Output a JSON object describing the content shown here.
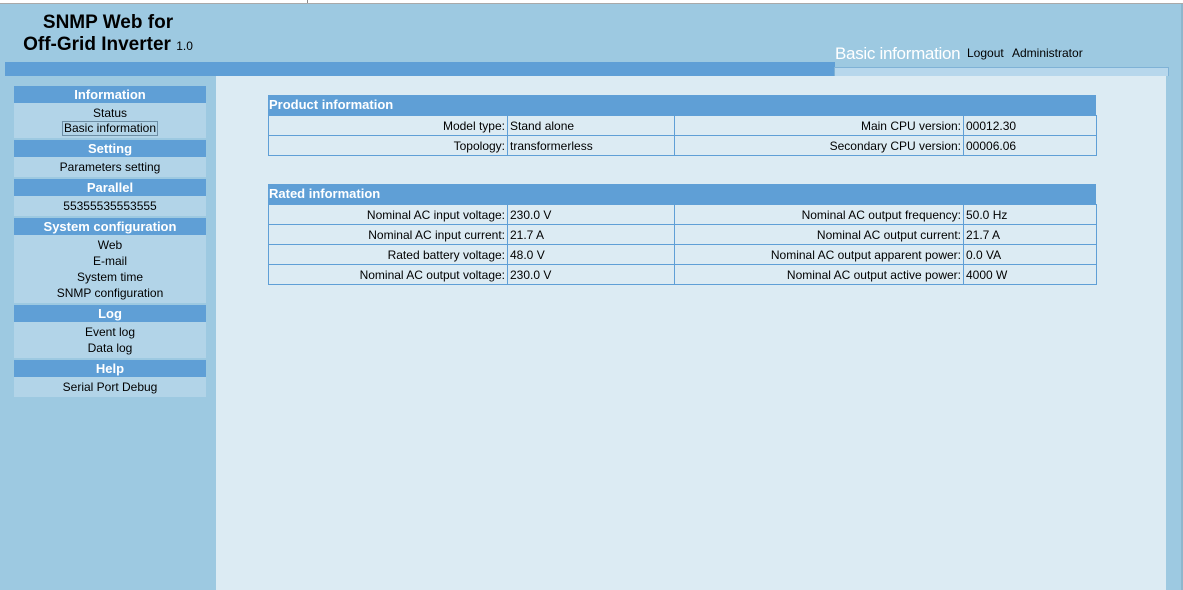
{
  "header": {
    "title_line1": "SNMP Web for",
    "title_line2": "Off-Grid Inverter",
    "version": "1.0",
    "page_title": "Basic information",
    "logout_label": "Logout",
    "user": "Administrator"
  },
  "sidebar": {
    "sections": [
      {
        "title": "Information",
        "items": [
          "Status",
          "Basic information"
        ]
      },
      {
        "title": "Setting",
        "items": [
          "Parameters setting"
        ]
      },
      {
        "title": "Parallel",
        "items": [
          "55355535553555"
        ]
      },
      {
        "title": "System configuration",
        "items": [
          "Web",
          "E-mail",
          "System time",
          "SNMP configuration"
        ]
      },
      {
        "title": "Log",
        "items": [
          "Event log",
          "Data log"
        ]
      },
      {
        "title": "Help",
        "items": [
          "Serial Port Debug"
        ]
      }
    ],
    "active_item": "Basic information"
  },
  "product": {
    "title": "Product information",
    "rows": [
      {
        "l_label": "Model type:",
        "l_value": "Stand alone",
        "r_label": "Main CPU version:",
        "r_value": "00012.30"
      },
      {
        "l_label": "Topology:",
        "l_value": "transformerless",
        "r_label": "Secondary CPU version:",
        "r_value": "00006.06"
      }
    ]
  },
  "rated": {
    "title": "Rated information",
    "rows": [
      {
        "l_label": "Nominal AC input voltage:",
        "l_value": "230.0 V",
        "r_label": "Nominal AC output frequency:",
        "r_value": "50.0 Hz"
      },
      {
        "l_label": "Nominal AC input current:",
        "l_value": "21.7 A",
        "r_label": "Nominal AC output current:",
        "r_value": "21.7 A"
      },
      {
        "l_label": "Rated battery voltage:",
        "l_value": "48.0 V",
        "r_label": "Nominal AC output apparent power:",
        "r_value": "0.0 VA"
      },
      {
        "l_label": "Nominal AC output voltage:",
        "l_value": "230.0 V",
        "r_label": "Nominal AC output active power:",
        "r_value": "4000 W"
      }
    ]
  },
  "colors": {
    "accent": "#5f9fd6",
    "background": "#9dc9e1",
    "content_bg": "#dcebf3"
  }
}
